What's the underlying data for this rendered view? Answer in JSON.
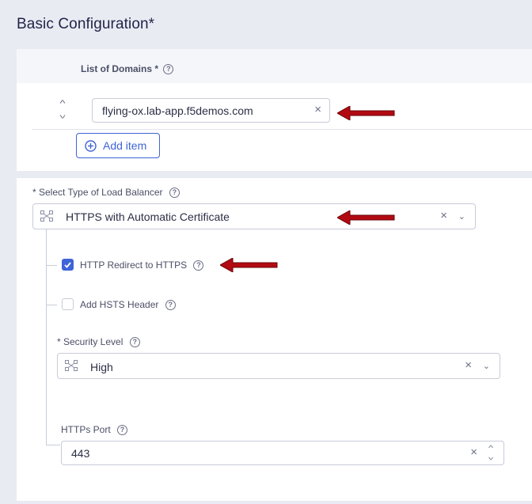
{
  "section": {
    "title": "Basic Configuration",
    "required_mark": "*"
  },
  "domains": {
    "label": "List of Domains *",
    "items": [
      {
        "value": "flying-ox.lab-app.f5demos.com"
      }
    ],
    "add_label": "Add item"
  },
  "load_balancer": {
    "label": "* Select Type of Load Balancer",
    "selected": "HTTPS with Automatic Certificate"
  },
  "options": {
    "http_redirect": {
      "label": "HTTP Redirect to HTTPS",
      "checked": true
    },
    "hsts": {
      "label": "Add HSTS Header",
      "checked": false
    }
  },
  "security": {
    "label": "* Security Level",
    "selected": "High"
  },
  "https_port": {
    "label": "HTTPs Port",
    "value": "443"
  },
  "colors": {
    "accent": "#3f63d8",
    "annotation_arrow": "#b20a12"
  },
  "icons": {
    "help": "question-circle-icon",
    "clear": "close-icon",
    "dropdown": "chevron-down-icon",
    "reorder": "sort-arrows-icon",
    "add": "plus-circle-icon",
    "type_option": "network-nodes-icon"
  }
}
